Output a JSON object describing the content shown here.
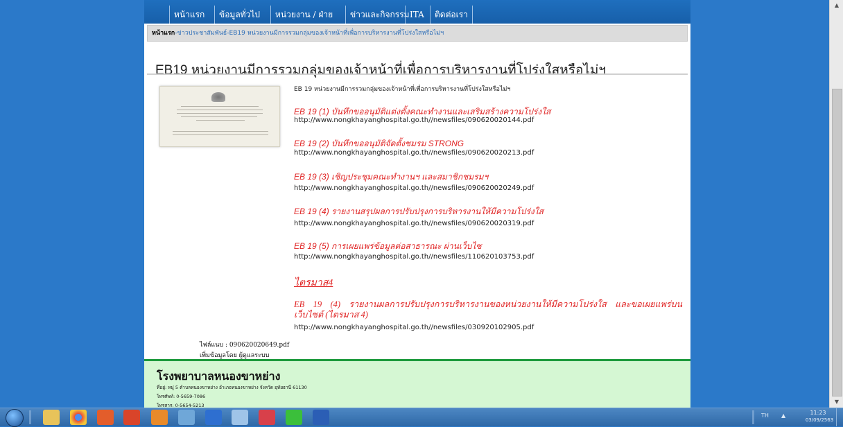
{
  "nav": {
    "items": [
      "หน้าแรก",
      "ข้อมูลทั่วไป",
      "หน่วยงาน / ฝ่าย",
      "ข่าวและกิจกรรม",
      "ITA",
      "ติดต่อเรา"
    ]
  },
  "breadcrumb": {
    "home": "หน้าแรก",
    "path": "-ข่าวประชาสัมพันธ์-EB19 หน่วยงานมีการรวมกลุ่มของเจ้าหน้าที่เพื่อการบริหารงานที่โปร่งใสหรือไม่ฯ"
  },
  "article": {
    "title": "EB19 หน่วยงานมีการรวมกลุ่มของเจ้าหน้าที่เพื่อการบริหารงานที่โปร่งใสหรือไม่ฯ",
    "intro": "EB 19 หน่วยงานมีการรวมกลุ่มของเจ้าหน้าที่เพื่อการบริหารงานที่โปร่งใสหรือไม่ฯ",
    "docs": [
      {
        "title": "EB 19 (1) บันทึกขออนุมัติแต่งตั้งคณะทำงานและเสริมสร้างความโปร่งใส",
        "url": "http://www.nongkhayanghospital.go.th//newsfiles/090620020144.pdf"
      },
      {
        "title": "EB 19 (2) บันทึกขออนุมัติจัดตั้งชมรม STRONG",
        "url": "http://www.nongkhayanghospital.go.th//newsfiles/090620020213.pdf"
      },
      {
        "title": "EB 19 (3) เชิญประชุมคณะทำงานฯ และสมาชิกชมรมฯ",
        "url": "http://www.nongkhayanghospital.go.th//newsfiles/090620020249.pdf"
      },
      {
        "title": "EB 19 (4) รายงานสรุปผลการปรับปรุงการบริหารงานให้มีความโปร่งใส",
        "url": "http://www.nongkhayanghospital.go.th//newsfiles/090620020319.pdf"
      },
      {
        "title": "EB 19 (5) การเผยแพร่ข้อมูลต่อสาธารณะ ผ่านเว็บไซ",
        "url": "http://www.nongkhayanghospital.go.th//newsfiles/110620103753.pdf"
      }
    ],
    "section_link": "ไตรมาส4",
    "extra_doc": {
      "title": "EB 19 (4) รายงานผลการปรับปรุงการบริหารงานของหน่วยงานให้มีความโปร่งใส และขอเผยแพร่บนเว็บไซต์ (ไตรมาส 4)",
      "url": "http://www.nongkhayanghospital.go.th//newsfiles/030920102905.pdf"
    },
    "attachment": "ไฟล์แนบ : 090620020649.pdf",
    "added_by": "เพิ่มข้อมูลโดย ผู้ดูแลระบบ"
  },
  "footer": {
    "org_name": "โรงพยาบาลหนองขาหย่าง",
    "address": "ที่อยู่: หมู่ 5 ตำบลหนองขาหย่าง อำเภอหนองขาหย่าง จังหวัด อุทัยธานี 61130",
    "tel": "โทรศัพท์: 0-5659-7086",
    "fax": "โทรสาร: 0-5654-5213"
  },
  "taskbar": {
    "icons": [
      "explorer-icon",
      "chrome-icon",
      "office-icon",
      "pdf-icon",
      "calculator-icon",
      "photos-icon",
      "teamviewer-icon",
      "search-tool-icon",
      "medical-app-icon",
      "line-icon",
      "word-icon"
    ],
    "lang": "TH",
    "time": "11:23",
    "date": "03/09/2563"
  },
  "colors": {
    "nav_bg": "#1f6fbe",
    "link_red": "#e02424",
    "footer_bg": "#d5f7d3",
    "footer_border": "#1d9a3c",
    "desktop_blue": "#2b79c9"
  }
}
